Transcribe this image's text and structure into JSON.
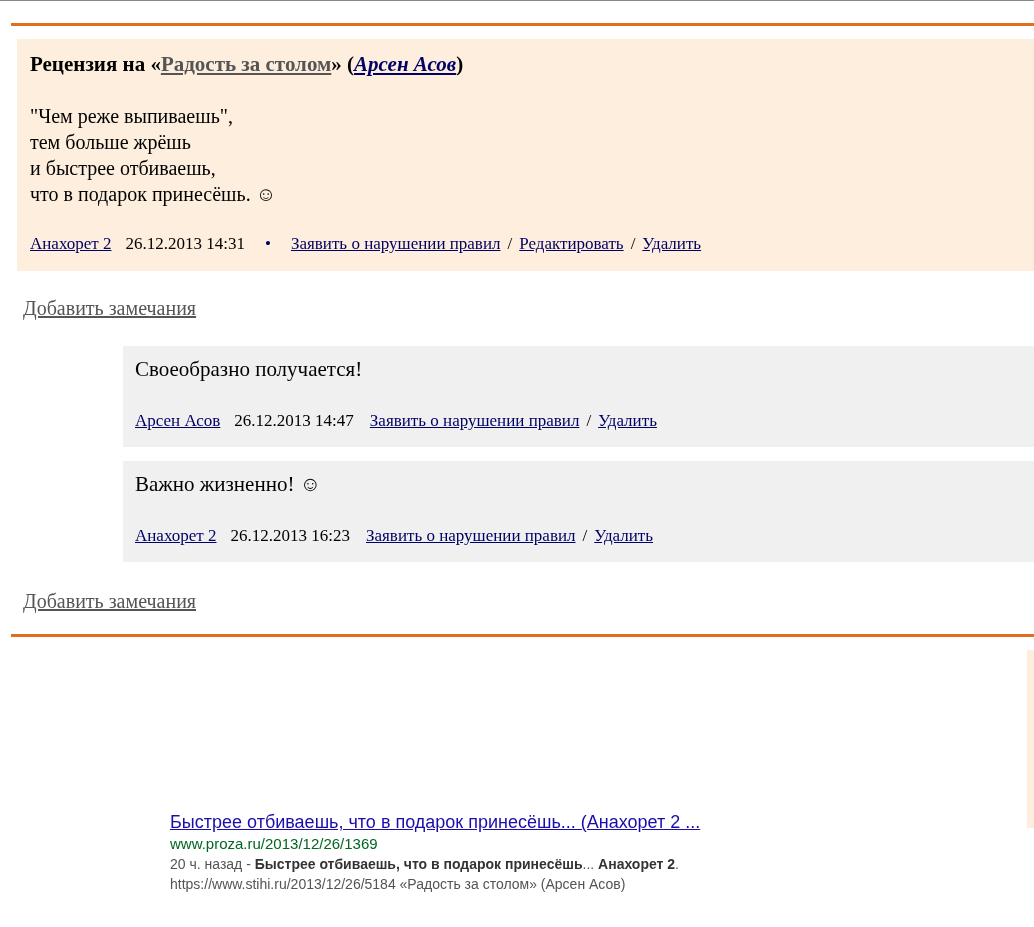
{
  "review": {
    "title": {
      "prefix": "Рецензия на «",
      "work": "Радость за столом",
      "middle": "» (",
      "author": "Арсен Асов",
      "suffix": ")"
    },
    "poem": [
      "\"Чем реже выпиваешь\",",
      "тем больше жрёшь",
      "и быстрее отбиваешь,",
      "что в подарок принесёшь. ☺"
    ],
    "footer": {
      "author": "Анахорет 2",
      "date": "26.12.2013 14:31",
      "bullet": "•",
      "actions": [
        {
          "label": "Заявить о нарушении правил"
        },
        {
          "separator": "/",
          "label": "Редактировать"
        },
        {
          "separator": "/",
          "label": "Удалить"
        }
      ]
    }
  },
  "add_remarks_top": "Добавить замечания",
  "comments": [
    {
      "text": "Своеобразно получается!",
      "author": "Арсен Асов",
      "date": "26.12.2013 14:47",
      "actions": [
        {
          "label": "Заявить о нарушении правил"
        },
        {
          "separator": "/",
          "label": "Удалить"
        }
      ]
    },
    {
      "text": "Важно жизненно! ☺",
      "author": "Анахорет 2",
      "date": "26.12.2013 16:23",
      "actions": [
        {
          "label": "Заявить о нарушении правил"
        },
        {
          "separator": "/",
          "label": "Удалить"
        }
      ]
    }
  ],
  "add_remarks_bottom": "Добавить замечания",
  "search_result": {
    "title": "Быстрее отбиваешь, что в подарок принесёшь... (Анахорет 2 ...",
    "url": "www.proza.ru/2013/12/26/1369",
    "snippet": "20 ч. назад - **Быстрее отбиваешь, что в подарок принесёшь**... **Анахорет 2**.",
    "snippet_line_2": "https://www.stihi.ru/2013/12/26/5184 «Радость за столом» (Арсен Асов)"
  }
}
